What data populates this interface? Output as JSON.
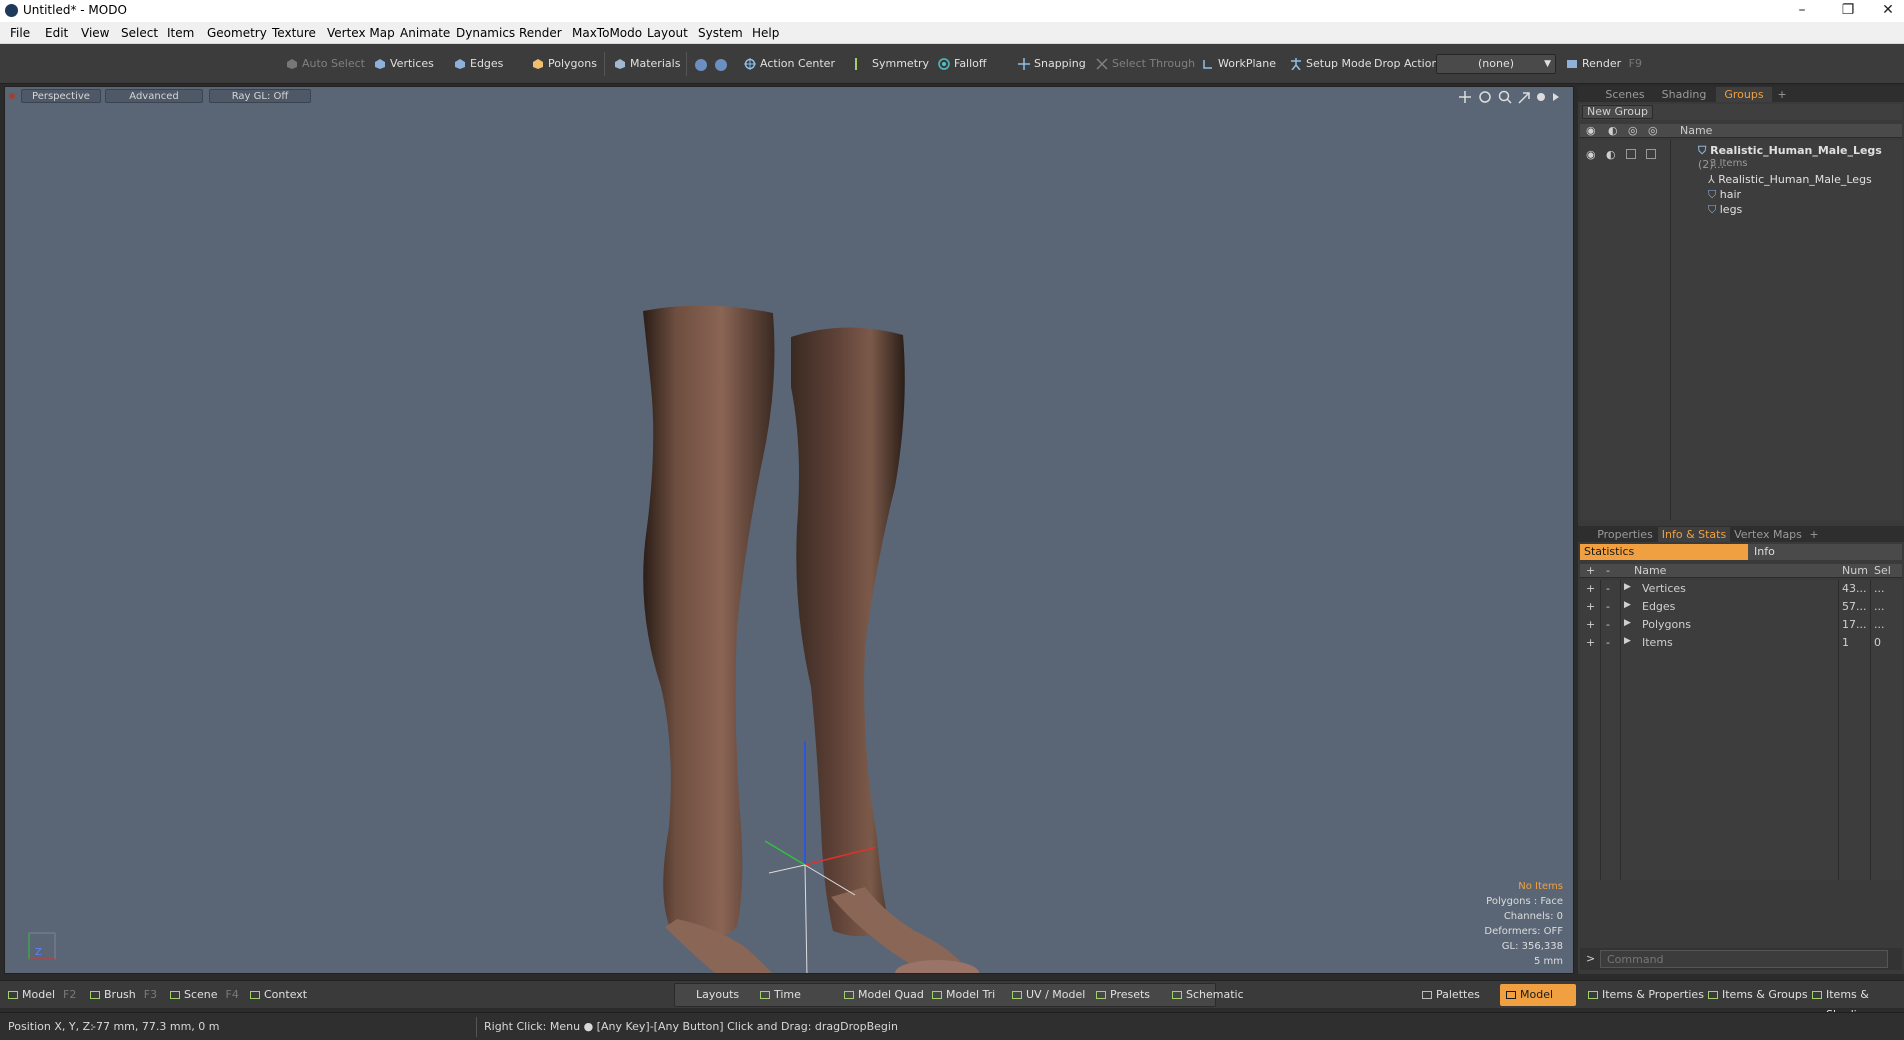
{
  "window": {
    "title": "Untitled* - MODO",
    "minimize": "–",
    "restore": "❐",
    "close": "✕"
  },
  "menu": [
    "File",
    "Edit",
    "View",
    "Select",
    "Item",
    "Geometry",
    "Texture",
    "Vertex Map",
    "Animate",
    "Dynamics",
    "Render",
    "MaxToModo",
    "Layout",
    "System",
    "Help"
  ],
  "toolbar": {
    "auto_select": "Auto Select",
    "vertices": "Vertices",
    "edges": "Edges",
    "polygons": "Polygons",
    "materials": "Materials",
    "action_center": "Action Center",
    "symmetry": "Symmetry",
    "falloff": "Falloff",
    "snapping": "Snapping",
    "select_through": "Select Through",
    "workplane": "WorkPlane",
    "setup_mode": "Setup Mode",
    "drop_action_label": "Drop Action",
    "drop_action_value": "(none)",
    "render": "Render",
    "render_key": "F9"
  },
  "viewport": {
    "view_mode": "Perspective",
    "shading": "Advanced",
    "raygl": "Ray GL: Off",
    "info": {
      "items": "No Items",
      "polygons": "Polygons : Face",
      "channels": "Channels: 0",
      "deformers": "Deformers: OFF",
      "gl": "GL: 356,338",
      "scale": "5 mm"
    },
    "axis_label": "Z"
  },
  "groups_panel": {
    "tabs": [
      "Scenes",
      "Shading",
      "Groups"
    ],
    "active_tab": "Groups",
    "new_group": "New Group",
    "col_name": "Name",
    "root": {
      "label": "Realistic_Human_Male_Legs",
      "count": "(2)...",
      "sub": "3 Items"
    },
    "children": [
      "Realistic_Human_Male_Legs",
      "hair",
      "legs"
    ]
  },
  "stats_panel": {
    "tabs": [
      "Properties",
      "Info & Stats",
      "Vertex Maps"
    ],
    "active_tab": "Info & Stats",
    "subtabs": {
      "statistics": "Statistics",
      "info": "Info"
    },
    "columns": {
      "name": "Name",
      "num": "Num",
      "sel": "Sel"
    },
    "rows": [
      {
        "name": "Vertices",
        "num": "43...",
        "sel": "..."
      },
      {
        "name": "Edges",
        "num": "57...",
        "sel": "..."
      },
      {
        "name": "Polygons",
        "num": "17...",
        "sel": "..."
      },
      {
        "name": "Items",
        "num": "1",
        "sel": "0"
      }
    ],
    "command_placeholder": "Command",
    "prompt": ">"
  },
  "bottom_bar": {
    "left": [
      {
        "label": "Model",
        "key": "F2"
      },
      {
        "label": "Brush",
        "key": "F3"
      },
      {
        "label": "Scene",
        "key": "F4"
      },
      {
        "label": "Context",
        "key": ""
      }
    ],
    "center": [
      "Layouts",
      "Time",
      "Model Quad",
      "Model Tri",
      "UV / Model",
      "Presets",
      "Schematic"
    ],
    "right": [
      "Palettes",
      "Model",
      "Items & Properties",
      "Items & Groups",
      "Items & Shading"
    ],
    "active_right": "Model"
  },
  "status": {
    "position_label": "Position X, Y, Z:",
    "position_value": "-77 mm, 77.3 mm, 0 m",
    "hint": "Right Click: Menu ●  [Any Key]-[Any Button] Click and Drag: dragDropBegin"
  },
  "colors": {
    "accent": "#f0a040",
    "viewport_bg": "#5a6676",
    "panel_bg": "#3a3a3a"
  }
}
